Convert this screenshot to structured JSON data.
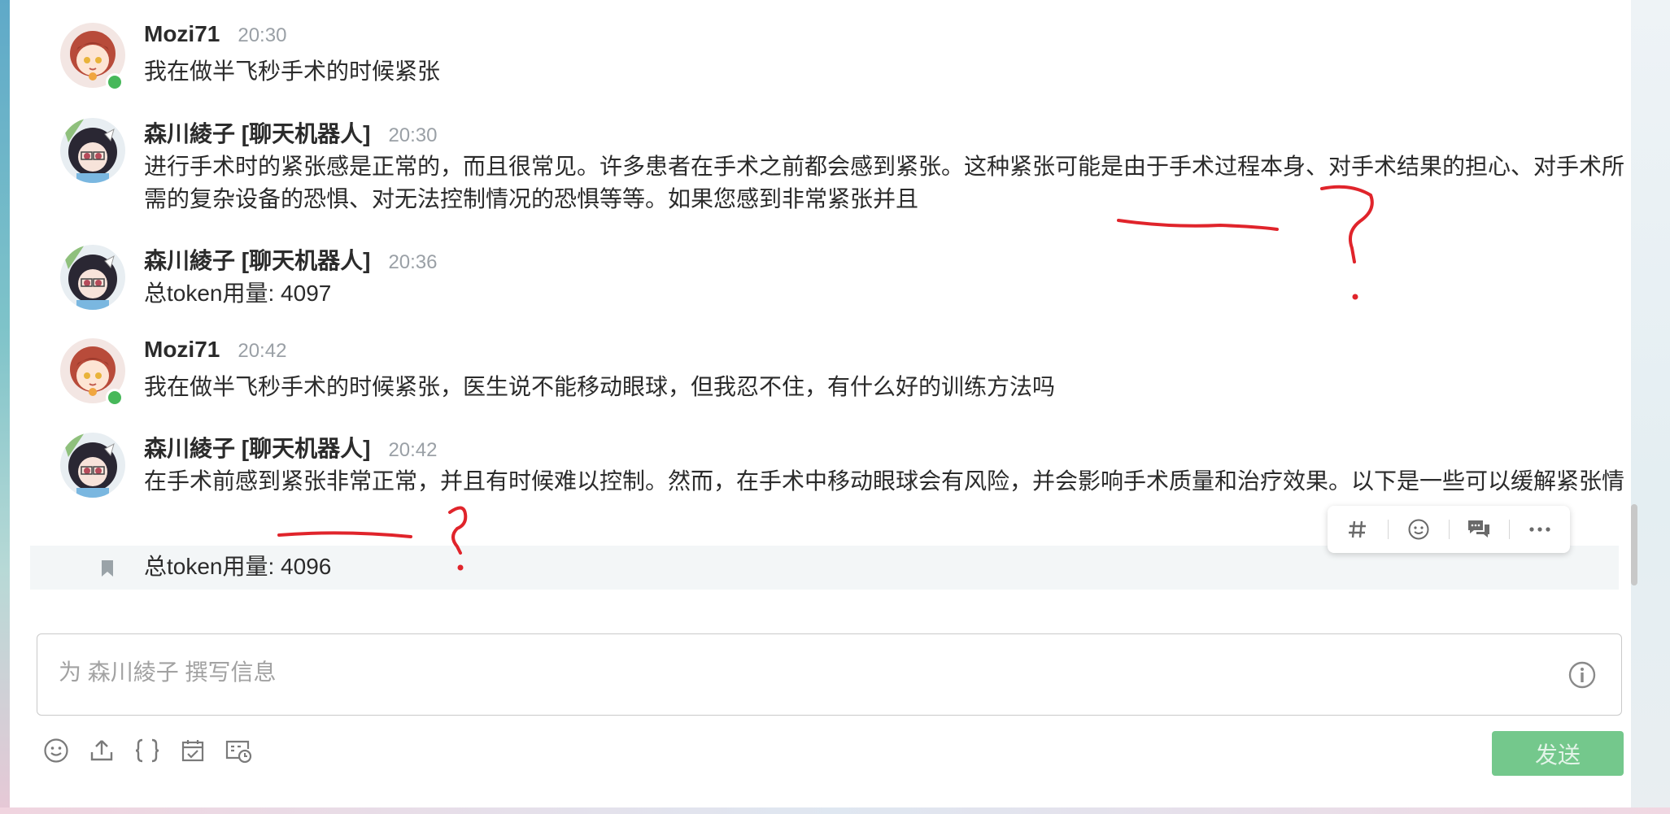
{
  "messages": [
    {
      "author": "Mozi71",
      "time": "20:30",
      "text": "我在做半飞秒手术的时候紧张"
    },
    {
      "author": "森川綾子 [聊天机器人]",
      "time": "20:30",
      "text": "进行手术时的紧张感是正常的，而且很常见。许多患者在手术之前都会感到紧张。这种紧张可能是由于手术过程本身、对手术结果的担心、对手术所需的复杂设备的恐惧、对无法控制情况的恐惧等等。如果您感到非常紧张并且"
    },
    {
      "author": "森川綾子 [聊天机器人]",
      "time": "20:36",
      "text": "总token用量: 4097"
    },
    {
      "author": "Mozi71",
      "time": "20:42",
      "text": "我在做半飞秒手术的时候紧张，医生说不能移动眼球，但我忍不住，有什么好的训练方法吗"
    },
    {
      "author": "森川綾子 [聊天机器人]",
      "time": "20:42",
      "text": "在手术前感到紧张非常正常，并且有时候难以控制。然而，在手术中移动眼球会有风险，并会影响手术质量和治疗效果。以下是一些可以缓解紧张情"
    }
  ],
  "followup": {
    "text": "总token用量: 4096"
  },
  "composer": {
    "placeholder": "为 森川綾子 撰写信息"
  },
  "send_button": {
    "label": "发送"
  },
  "colors": {
    "accent_green": "#5cbf78",
    "status_online": "#47b85a",
    "annotation_red": "#e0242b"
  },
  "icons": {
    "hover_toolbar": [
      "hash-icon",
      "emoji-reaction-icon",
      "reply-thread-icon",
      "more-options-icon"
    ],
    "composer_tools": [
      "emoji-icon",
      "upload-icon",
      "code-braces-icon",
      "calendar-check-icon",
      "card-clock-icon"
    ]
  }
}
